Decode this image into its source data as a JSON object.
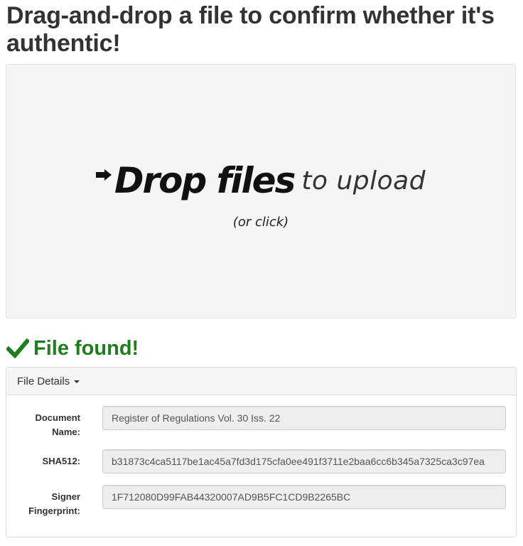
{
  "page": {
    "title": "Drag-and-drop a file to confirm whether it's authentic!"
  },
  "dropzone": {
    "strong_text": "Drop files",
    "light_text": "to upload",
    "hint": "(or click)",
    "icon": "arrow-right-icon"
  },
  "status": {
    "icon": "checkmark-icon",
    "text": "File found!",
    "color": "#1f7d1f"
  },
  "panel": {
    "heading": "File Details",
    "heading_icon": "caret-down-icon",
    "fields": [
      {
        "label": "Document Name:",
        "value": "Register of Regulations Vol. 30 Iss. 22"
      },
      {
        "label": "SHA512:",
        "value": "b31873c4ca5117be1ac45a7fd3d175cfa0ee491f3711e2baa6cc6b345a7325ca3c97ea"
      },
      {
        "label": "Signer Fingerprint:",
        "value": "1F712080D99FAB44320007AD9B5FC1CD9B2265BC"
      }
    ]
  }
}
